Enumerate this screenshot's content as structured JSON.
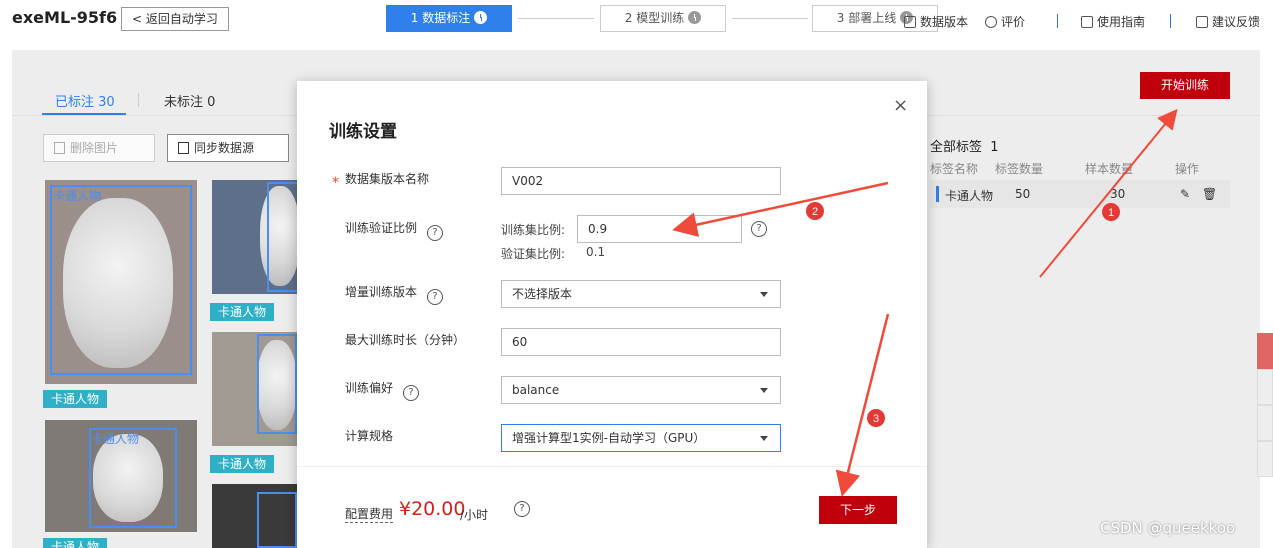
{
  "header": {
    "app_title": "exeML-95f6",
    "back_label": "返回自动学习",
    "steps": [
      "1 数据标注",
      "2 模型训练",
      "3 部署上线"
    ],
    "links": [
      "数据版本",
      "评价",
      "使用指南",
      "建议反馈"
    ]
  },
  "workspace": {
    "tabs": [
      "已标注 30",
      "未标注 0"
    ],
    "delete_label": "删除图片",
    "sync_label": "同步数据源",
    "tag_name": "卡通人物",
    "start_train_label": "开始训练",
    "labels_title": "全部标签",
    "labels_count": "1",
    "columns": [
      "标签名称",
      "标签数量",
      "样本数量",
      "操作"
    ],
    "row": {
      "name": "卡通人物",
      "label_count": "50",
      "sample_count": "30"
    }
  },
  "modal": {
    "title": "训练设置",
    "close": "×",
    "fields": {
      "dataset_version_label": "数据集版本名称",
      "dataset_version_value": "V002",
      "split_label": "训练验证比例",
      "train_ratio_label": "训练集比例:",
      "train_ratio_value": "0.9",
      "val_ratio_label": "验证集比例:",
      "val_ratio_value": "0.1",
      "incremental_label": "增量训练版本",
      "incremental_value": "不选择版本",
      "max_time_label": "最大训练时长（分钟）",
      "max_time_value": "60",
      "preference_label": "训练偏好",
      "preference_value": "balance",
      "compute_label": "计算规格",
      "compute_value": "增强计算型1实例-自动学习（GPU）"
    },
    "fee_label": "配置费用",
    "fee_value": "¥20.00",
    "fee_unit": "/小时",
    "next_label": "下一步"
  },
  "annotations": [
    "1",
    "2",
    "3"
  ],
  "watermark": "CSDN @queekkoo",
  "colors": {
    "primary": "#2f80ed",
    "danger": "#c0000b",
    "tag": "#2fb0c7",
    "arrow": "#f04a3a"
  }
}
